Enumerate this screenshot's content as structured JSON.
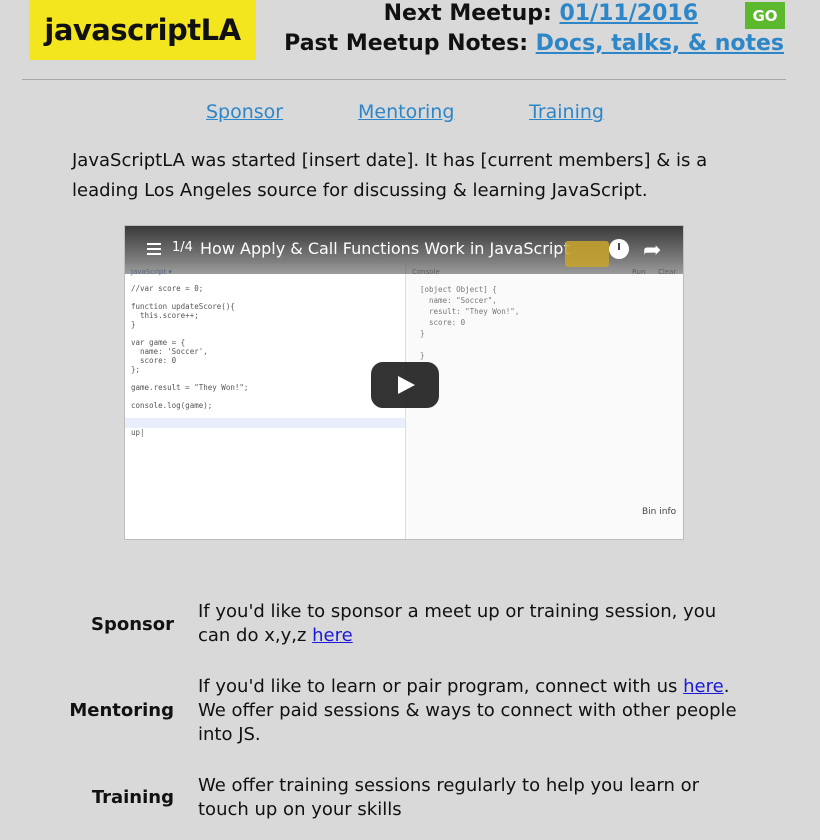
{
  "brand": {
    "name": "javascriptLA"
  },
  "header": {
    "next_meetup_label": "Next Meetup:",
    "next_meetup_date": "01/11/2016",
    "go_label": "GO",
    "past_notes_label": "Past Meetup Notes:",
    "past_notes_link": "Docs, talks, & notes"
  },
  "nav": {
    "items": [
      {
        "label": "Sponsor"
      },
      {
        "label": "Mentoring"
      },
      {
        "label": "Training"
      }
    ]
  },
  "intro": {
    "text": "JavaScriptLA was started [insert date]. It has [current members] & is a leading Los Angeles source for discussing & learning JavaScript."
  },
  "video": {
    "count": "1/4",
    "title": "How Apply & Call Functions Work in JavaScript",
    "editor_label": "JavaScript ▾",
    "console_label": "Console",
    "run_label": "Run",
    "clear_label": "Clear",
    "bin_info": "Bin info",
    "code_lines": [
      "//var score = 0;",
      "",
      "function updateScore(){",
      "  this.score++;",
      "}",
      "",
      "var game = {",
      "  name: 'Soccer',",
      "  score: 0",
      "};",
      "",
      "game.result = \"They Won!\";",
      "",
      "console.log(game);",
      "",
      "",
      "up|"
    ],
    "console_lines": [
      "[object Object] {",
      "  name: \"Soccer\",",
      "  result: \"They Won!\",",
      "  score: 0",
      "}",
      "",
      "}"
    ],
    "icons": {
      "menu": "playlist-icon",
      "clock": "watch-later-icon",
      "share": "share-icon",
      "play": "play-icon"
    }
  },
  "sections": [
    {
      "label": "Sponsor",
      "text_before": "If you'd like to sponsor a meet up or training session, you can do x,y,z ",
      "link": "here",
      "text_after": ""
    },
    {
      "label": "Mentoring",
      "text_before": "If you'd like to learn or pair program, connect with us ",
      "link": "here",
      "text_after": ". We offer paid sessions & ways to connect with other people into JS."
    },
    {
      "label": "Training",
      "text_before": "We offer training sessions regularly to help you learn or touch up on your skills",
      "link": "",
      "text_after": ""
    }
  ],
  "colors": {
    "background": "#d9d9d9",
    "logo_bg": "#f4e61e",
    "link": "#2d86c7",
    "go_button": "#5cb82c",
    "inline_link": "#1a1ad6"
  }
}
